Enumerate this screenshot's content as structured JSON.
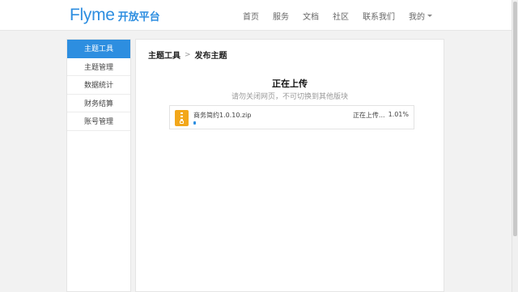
{
  "header": {
    "logo_text": "Flyme",
    "logo_sub": "开放平台",
    "nav": [
      "首页",
      "服务",
      "文档",
      "社区",
      "联系我们"
    ],
    "account_label": "我的"
  },
  "sidebar": {
    "items": [
      {
        "label": "主题工具",
        "active": true
      },
      {
        "label": "主题管理",
        "active": false
      },
      {
        "label": "数据统计",
        "active": false
      },
      {
        "label": "财务结算",
        "active": false
      },
      {
        "label": "账号管理",
        "active": false
      }
    ]
  },
  "main": {
    "breadcrumb": [
      "主题工具",
      ">",
      "发布主题"
    ],
    "status_title": "正在上传",
    "status_subtitle": "请勿关闭网页，不可切换到其他版块",
    "file": {
      "name": "商务简约1.0.10.zip",
      "status_text": "正在上传...",
      "percent_text": "1.01%",
      "progress_fraction": 0.0101
    }
  },
  "colors": {
    "accent": "#2d8ee0",
    "zip_icon": "#f2a71b"
  },
  "icons": {
    "file": "zip-file-icon",
    "dropdown": "chevron-down-icon"
  }
}
